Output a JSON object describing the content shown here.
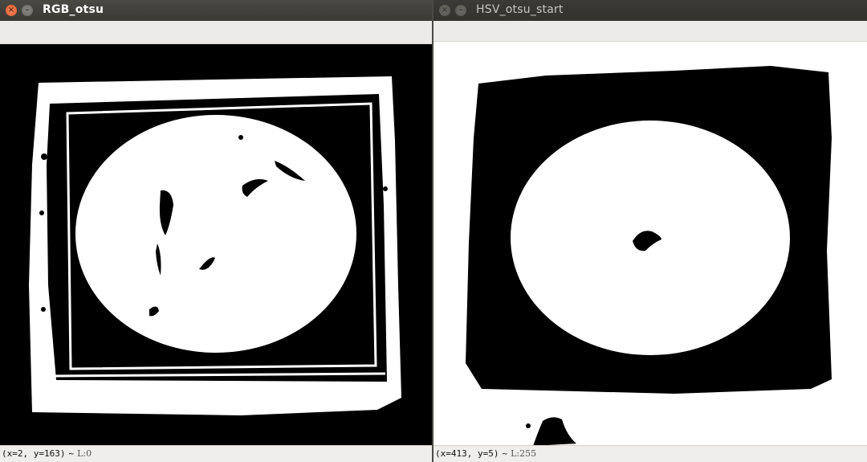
{
  "windows": {
    "left": {
      "title": "RGB_otsu",
      "status": {
        "coords": "(x=2, y=163)",
        "sep": "~",
        "value": "L:0"
      }
    },
    "right": {
      "title": "HSV_otsu_start",
      "status": {
        "coords": "(x=413, y=5)",
        "sep": "~",
        "value": "L:255"
      }
    }
  },
  "icons": {
    "close": "close-icon",
    "minimize": "minimize-icon"
  },
  "colors": {
    "close_active": "#e2592b",
    "titlebar": "#3c3b37",
    "mask_fg": "#ffffff",
    "mask_bg": "#000000"
  }
}
